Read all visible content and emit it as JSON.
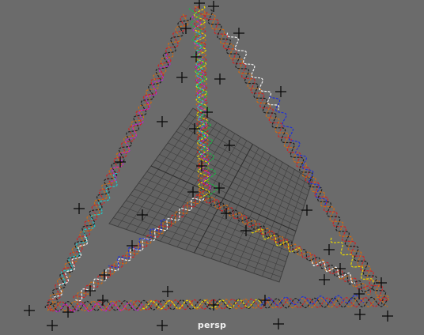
{
  "viewport": {
    "camera_label": "persp",
    "background": "#6b6b6b",
    "grid_color": "#3e3e3e"
  },
  "strand_colors": [
    "#d42020",
    "#d06a10",
    "#e8d800",
    "#1f2fd8",
    "#c020d0",
    "#20c8c8",
    "#f0f0f0",
    "#202020",
    "#10c040"
  ]
}
